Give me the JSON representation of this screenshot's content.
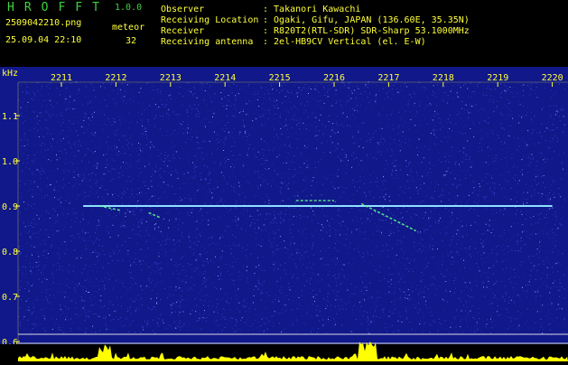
{
  "app": {
    "title": "HROFFT",
    "version": "1.0.0",
    "filename": "2509042210.png",
    "datetime": "25.09.04 22:10",
    "meteor_label": "meteor",
    "meteor_count": "32"
  },
  "info": [
    {
      "label": "Observer",
      "value": ": Takanori Kawachi"
    },
    {
      "label": "Receiving Location",
      "value": ": Ogaki, Gifu, JAPAN (136.60E, 35.35N)"
    },
    {
      "label": "Receiver",
      "value": ": R820T2(RTL-SDR) SDR-Sharp 53.1000MHz"
    },
    {
      "label": "Receiving antenna",
      "value": ": 2el-HB9CV Vertical (el. E-W)"
    }
  ],
  "chart_data": {
    "type": "heatmap",
    "ylabel": "kHz",
    "x_ticks": [
      "2211",
      "2212",
      "2213",
      "2214",
      "2215",
      "2216",
      "2217",
      "2218",
      "2219",
      "2220"
    ],
    "y_ticks": [
      "1.1",
      "1.0",
      "0.9",
      "0.8",
      "0.7",
      "0.6"
    ],
    "y_tick_values": [
      1.1,
      1.0,
      0.9,
      0.8,
      0.7,
      0.6
    ],
    "ylim": [
      0.58,
      1.21
    ],
    "carrier_khz": 0.9,
    "carrier_range": [
      "2211.4",
      "2220.0"
    ],
    "meteor_echoes": [
      {
        "start": "2211.7",
        "end": "2212.1",
        "f_start": 0.9,
        "f_end": 0.89
      },
      {
        "start": "2212.6",
        "end": "2212.8",
        "f_start": 0.885,
        "f_end": 0.875
      },
      {
        "start": "2216.5",
        "end": "2217.5",
        "f_start": 0.905,
        "f_end": 0.845
      },
      {
        "start": "2215.3",
        "end": "2216.0",
        "f_start": 0.912,
        "f_end": 0.912
      }
    ],
    "colors": {
      "background": "#10188a",
      "noise": "#3a46d8",
      "carrier": "#8fe0ff",
      "echo": "#64ff8a",
      "amplitude": "#ffff00",
      "text_header": "#ffff3a",
      "text_title": "#3fd23f"
    }
  }
}
